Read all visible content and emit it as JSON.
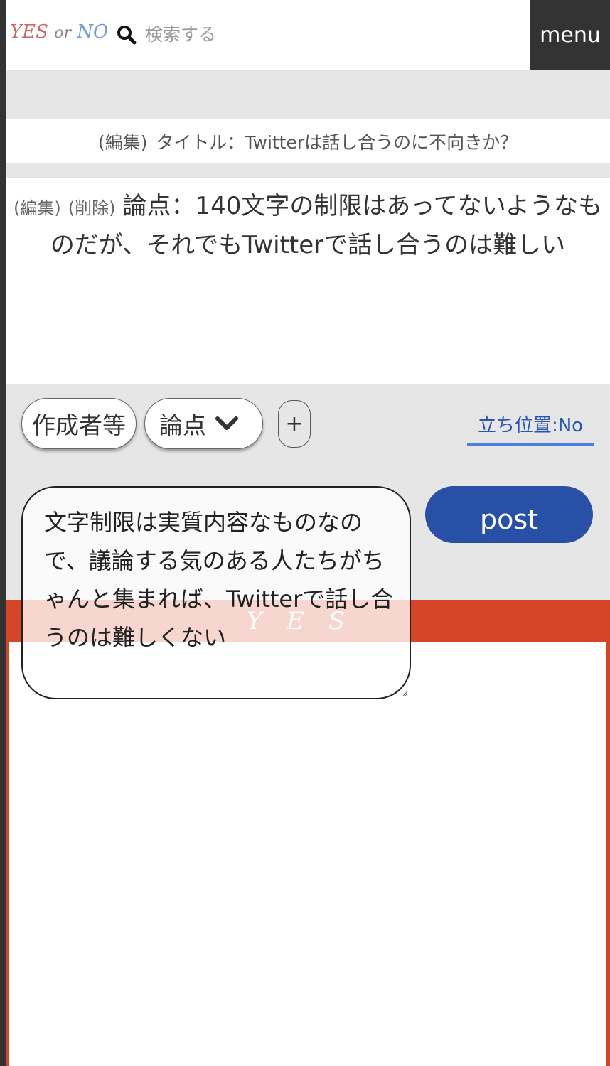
{
  "header": {
    "logo": {
      "yes": "YES",
      "or": "or",
      "no": "NO"
    },
    "search_placeholder": "検索する",
    "menu_label": "menu"
  },
  "title_box": {
    "edit_link": "(編集)",
    "title": "タイトル：Twitterは話し合うのに不向きか？"
  },
  "point_box": {
    "edit_link": "(編集)",
    "delete_link": "(削除)",
    "text": "論点：140文字の制限はあってないようなものだが、それでもTwitterで話し合うのは難しい"
  },
  "controls": {
    "author_chip": "作成者等",
    "point_chip": "論点",
    "add_label": "+",
    "stance_tab": "立ち位置:No"
  },
  "composer": {
    "text": "文字制限は実質内容なものなので、議論する気のある人たちがちゃんと集まれば、Twitterで話し合うのは難しくない",
    "post_label": "post"
  },
  "yes_section": {
    "label": "YES"
  },
  "colors": {
    "accent_blue": "#2750a6",
    "yes_red": "#d64528",
    "dark": "#333333"
  }
}
